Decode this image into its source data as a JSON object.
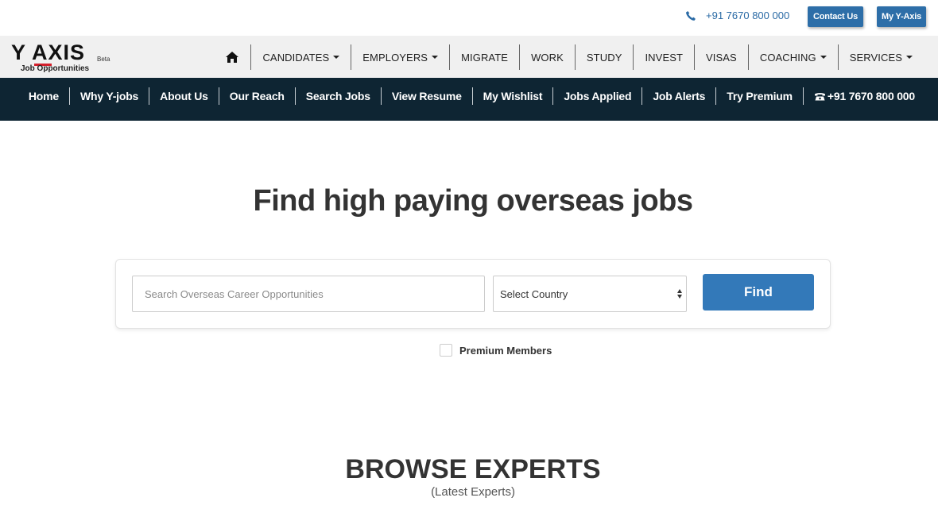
{
  "topbar": {
    "phone": "+91 7670 800 000",
    "contact_label": "Contact Us",
    "myaxis_label": "My Y-Axis"
  },
  "logo": {
    "word": "Y AXIS",
    "beta": "Beta",
    "sub": "Job Opportunities",
    "accent": "#d21f2b"
  },
  "mainnav": {
    "items": [
      {
        "label": "CANDIDATES",
        "dropdown": true
      },
      {
        "label": "EMPLOYERS",
        "dropdown": true
      },
      {
        "label": "MIGRATE",
        "dropdown": false
      },
      {
        "label": "WORK",
        "dropdown": false
      },
      {
        "label": "STUDY",
        "dropdown": false
      },
      {
        "label": "INVEST",
        "dropdown": false
      },
      {
        "label": "VISAS",
        "dropdown": false
      },
      {
        "label": "COACHING",
        "dropdown": true
      },
      {
        "label": "SERVICES",
        "dropdown": true
      }
    ]
  },
  "subnav": {
    "items": [
      "Home",
      "Why Y-jobs",
      "About Us",
      "Our Reach",
      "Search Jobs",
      "View Resume",
      "My Wishlist",
      "Jobs Applied",
      "Job Alerts",
      "Try Premium"
    ],
    "phone": "+91 7670 800 000"
  },
  "hero": {
    "title": "Find high paying overseas jobs",
    "search_placeholder": "Search Overseas Career Opportunities",
    "country_selected": "Select Country",
    "find_label": "Find",
    "premium_label": "Premium Members"
  },
  "browse": {
    "title": "BROWSE EXPERTS",
    "subtitle": "(Latest Experts)"
  },
  "colors": {
    "primary_blue": "#3379b9",
    "dark_navy": "#0e2533"
  }
}
